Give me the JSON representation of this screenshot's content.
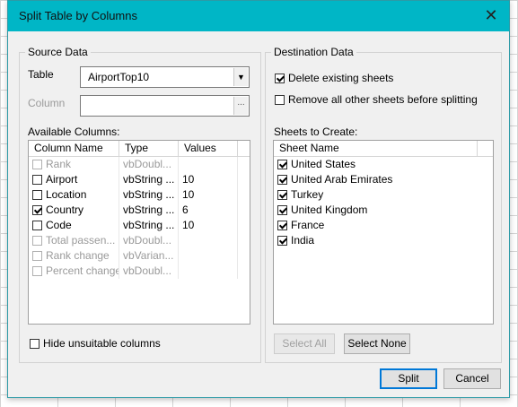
{
  "window": {
    "title": "Split Table by Columns",
    "close_glyph": "✕"
  },
  "source": {
    "legend": "Source Data",
    "table_label": "Table",
    "table_value": "AirportTop10",
    "column_label": "Column",
    "column_value": "",
    "available_label": "Available Columns:",
    "headers": [
      "Column Name",
      "Type",
      "Values"
    ],
    "rows": [
      {
        "name": "Rank",
        "type": "vbDoubl...",
        "values": "",
        "checked": false,
        "enabled": false
      },
      {
        "name": "Airport",
        "type": "vbString ...",
        "values": "10",
        "checked": false,
        "enabled": true
      },
      {
        "name": "Location",
        "type": "vbString ...",
        "values": "10",
        "checked": false,
        "enabled": true
      },
      {
        "name": "Country",
        "type": "vbString ...",
        "values": "6",
        "checked": true,
        "enabled": true
      },
      {
        "name": "Code",
        "type": "vbString ...",
        "values": "10",
        "checked": false,
        "enabled": true
      },
      {
        "name": "Total passen...",
        "type": "vbDoubl...",
        "values": "",
        "checked": false,
        "enabled": false
      },
      {
        "name": "Rank change",
        "type": "vbVarian...",
        "values": "",
        "checked": false,
        "enabled": false
      },
      {
        "name": "Percent change",
        "type": "vbDoubl...",
        "values": "",
        "checked": false,
        "enabled": false
      }
    ],
    "hide_unsuitable_label": "Hide unsuitable columns",
    "hide_unsuitable_checked": false
  },
  "destination": {
    "legend": "Destination Data",
    "delete_existing_label": "Delete existing sheets",
    "delete_existing_checked": true,
    "remove_others_label": "Remove all other sheets before splitting",
    "remove_others_checked": false,
    "sheets_label": "Sheets to Create:",
    "header": "Sheet Name",
    "sheets": [
      {
        "name": "United States",
        "checked": true
      },
      {
        "name": "United Arab Emirates",
        "checked": true
      },
      {
        "name": "Turkey",
        "checked": true
      },
      {
        "name": "United Kingdom",
        "checked": true
      },
      {
        "name": "France",
        "checked": true
      },
      {
        "name": "India",
        "checked": true
      }
    ],
    "select_all_label": "Select All",
    "select_none_label": "Select None"
  },
  "footer": {
    "split_label": "Split",
    "cancel_label": "Cancel"
  }
}
